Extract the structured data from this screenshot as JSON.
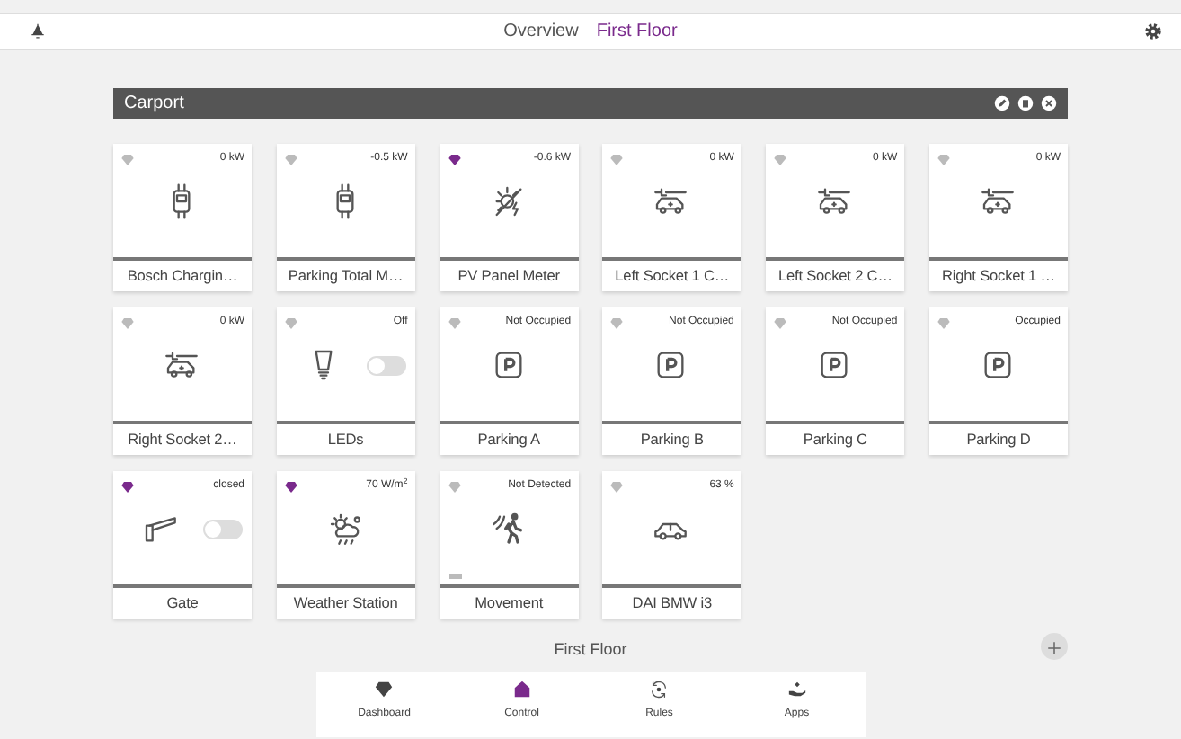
{
  "top_bar": {
    "tabs": [
      {
        "label": "Overview",
        "selected": false
      },
      {
        "label": "First Floor",
        "selected": true
      }
    ]
  },
  "group": {
    "title": "Carport",
    "tiles": [
      {
        "name": "Bosch Chargin…",
        "value": "0 kW",
        "kind": "meter",
        "active": false
      },
      {
        "name": "Parking Total M…",
        "value": "-0.5 kW",
        "kind": "meter",
        "active": false
      },
      {
        "name": "PV Panel Meter",
        "value": "-0.6 kW",
        "kind": "solar",
        "active": true
      },
      {
        "name": "Left Socket 1 C…",
        "value": "0 kW",
        "kind": "ev",
        "active": false
      },
      {
        "name": "Left Socket 2 C…",
        "value": "0 kW",
        "kind": "ev",
        "active": false
      },
      {
        "name": "Right Socket 1 …",
        "value": "0 kW",
        "kind": "ev",
        "active": false
      },
      {
        "name": "Right Socket 2…",
        "value": "0 kW",
        "kind": "ev",
        "active": false
      },
      {
        "name": "LEDs",
        "value": "Off",
        "kind": "bulb",
        "active": false,
        "on": false
      },
      {
        "name": "Parking A",
        "value": "Not Occupied",
        "kind": "parking",
        "active": false
      },
      {
        "name": "Parking B",
        "value": "Not Occupied",
        "kind": "parking",
        "active": false
      },
      {
        "name": "Parking C",
        "value": "Not Occupied",
        "kind": "parking",
        "active": false
      },
      {
        "name": "Parking D",
        "value": "Occupied",
        "kind": "parking",
        "active": false
      },
      {
        "name": "Gate",
        "value": "closed",
        "kind": "barrier",
        "active": true,
        "on": false
      },
      {
        "name": "Weather Station",
        "value": "70 W/m$^{2}$",
        "kind": "weather",
        "active": true
      },
      {
        "name": "Movement",
        "value": "Not Detected",
        "kind": "walker",
        "active": false,
        "low_battery": true
      },
      {
        "name": "DAI BMW i3",
        "value": "63 %",
        "kind": "car",
        "active": false
      }
    ]
  },
  "floor_label": "First Floor",
  "bottom_nav": [
    {
      "label": "Dashboard",
      "kind": "gem",
      "selected": false
    },
    {
      "label": "Control",
      "kind": "house",
      "selected": true
    },
    {
      "label": "Rules",
      "kind": "sync",
      "selected": false
    },
    {
      "label": "Apps",
      "kind": "hand",
      "selected": false
    }
  ]
}
